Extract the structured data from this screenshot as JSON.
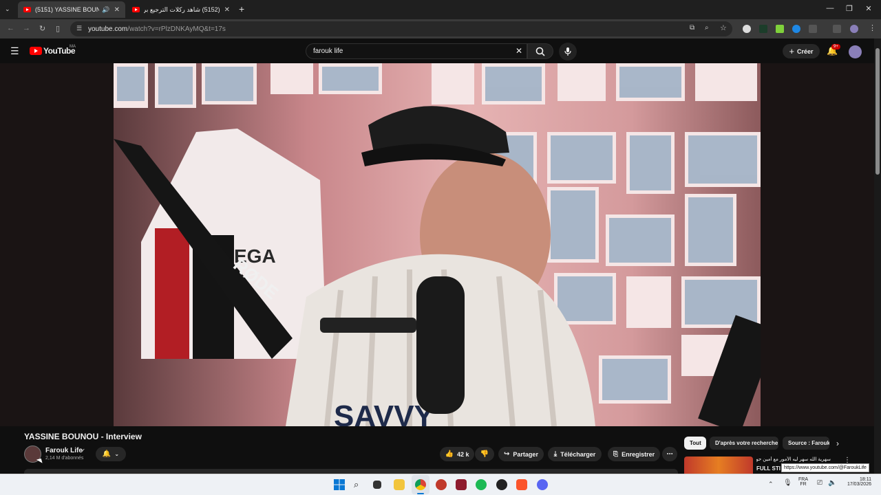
{
  "browser": {
    "tabs": [
      {
        "title": "(5151) YASSINE BOUNOU -",
        "active": true
      },
      {
        "title": "(5152) شاهد ركلات الترجيع بر...",
        "active": false
      }
    ],
    "new_tab": "+",
    "url_domain": "youtube.com",
    "url_path": "/watch?v=rPlzDNKAyMQ&t=17s"
  },
  "youtube": {
    "logo_text": "YouTube",
    "country_code": "MA",
    "search_value": "farouk life",
    "create_label": "Créer",
    "notification_badge": "9+"
  },
  "video": {
    "title": "YASSINE BOUNOU - Interview",
    "channel_name": "Farouk Life",
    "subscribers": "2,14 M d'abonnés",
    "likes": "42 k",
    "share_label": "Partager",
    "download_label": "Télécharger",
    "save_label": "Enregistrer"
  },
  "suggestions": {
    "chips": [
      "Tout",
      "D'après votre recherche",
      "Source : Farouk"
    ],
    "item_title": "سهرية الله سهر ليه الأمور مع أمين حول",
    "item_subtitle": "FULL STI",
    "tooltip_url": "https://www.youtube.com/@FaroukLife"
  },
  "taskbar": {
    "lang_top": "FRA",
    "lang_bottom": "FR",
    "time": "18:11",
    "date": "17/03/2026"
  },
  "colors": {
    "accent_red": "#ff0000",
    "page_bg": "#0f0f0f",
    "chip_selected": "#f1f1f1"
  }
}
